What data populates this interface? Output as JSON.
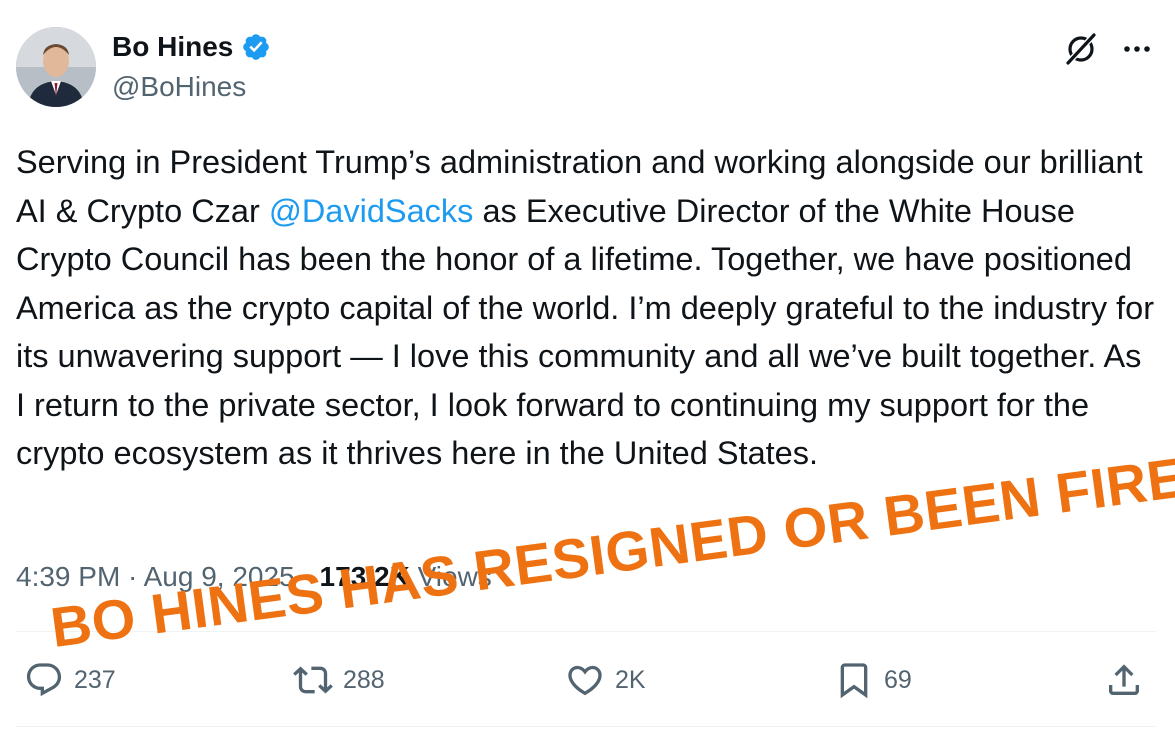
{
  "author": {
    "name": "Bo Hines",
    "handle": "@BoHines",
    "verified": true
  },
  "post": {
    "text_before_mention": "Serving in President Trump’s administration and working alongside our brilliant AI & Crypto Czar ",
    "mention": "@DavidSacks",
    "text_after_mention": " as Executive Director of the White House Crypto Council has been the honor of a lifetime. Together, we have positioned America as the crypto capital of the world. I’m deeply grateful to the industry for its unwavering support — I love this community and all we’ve built together. As I return to the private sector, I look forward to continuing my support for the crypto ecosystem as it thrives here in the United States."
  },
  "meta": {
    "time": "4:39 PM",
    "separator1": " · ",
    "date": "Aug 9, 2025",
    "separator2": " · ",
    "views_count": "173.2K",
    "views_label": " Views"
  },
  "actions": {
    "replies": "237",
    "reposts": "288",
    "likes": "2K",
    "bookmarks": "69"
  },
  "overlay_caption": "BO HINES HAS RESIGNED OR BEEN FIRED",
  "icons": {
    "verified": "verified-badge-icon",
    "grok": "grok-icon",
    "more": "more-options-icon",
    "reply": "reply-icon",
    "repost": "repost-icon",
    "like": "heart-icon",
    "bookmark": "bookmark-icon",
    "share": "share-icon"
  },
  "colors": {
    "text": "#0f1419",
    "secondary": "#536471",
    "link": "#1d9bf0",
    "verified": "#1d9bf0",
    "overlay": "#ee7212"
  }
}
